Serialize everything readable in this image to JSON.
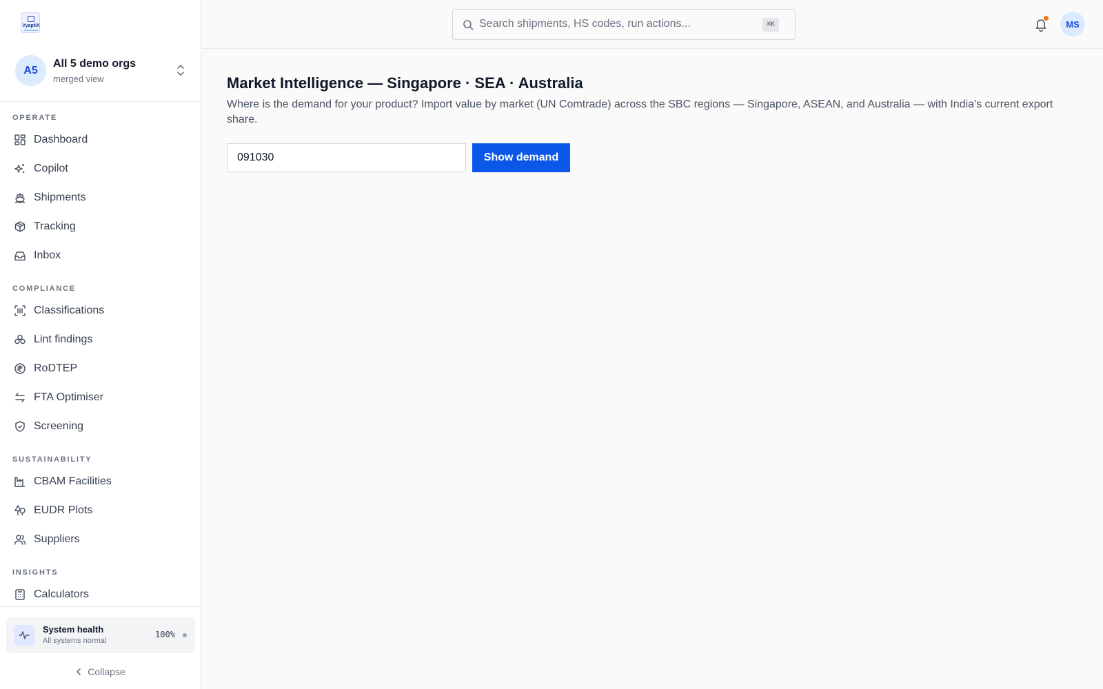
{
  "brand": {
    "logo_text": "VyaptiX"
  },
  "org": {
    "avatar": "A5",
    "name": "All 5 demo orgs",
    "sub": "merged view"
  },
  "nav": {
    "sections": [
      {
        "label": "OPERATE",
        "items": [
          "Dashboard",
          "Copilot",
          "Shipments",
          "Tracking",
          "Inbox"
        ]
      },
      {
        "label": "COMPLIANCE",
        "items": [
          "Classifications",
          "Lint findings",
          "RoDTEP",
          "FTA Optimiser",
          "Screening"
        ]
      },
      {
        "label": "SUSTAINABILITY",
        "items": [
          "CBAM Facilities",
          "EUDR Plots",
          "Suppliers"
        ]
      },
      {
        "label": "INSIGHTS",
        "items": [
          "Calculators"
        ]
      }
    ]
  },
  "health": {
    "title": "System health",
    "sub": "All systems normal",
    "pct": "100%"
  },
  "collapse_label": "Collapse",
  "search": {
    "placeholder": "Search shipments, HS codes, run actions...",
    "shortcut": "⌘K"
  },
  "user": {
    "initials": "MS"
  },
  "colors": {
    "accent": "#0b57e8",
    "notification": "#f97316",
    "avatar_bg": "#dbeafe"
  },
  "main": {
    "title": "Market Intelligence — Singapore · SEA · Australia",
    "description": "Where is the demand for your product? Import value by market (UN Comtrade) across the SBC regions — Singapore, ASEAN, and Australia — with India's current export share.",
    "hs_value": "091030",
    "button_label": "Show demand"
  }
}
